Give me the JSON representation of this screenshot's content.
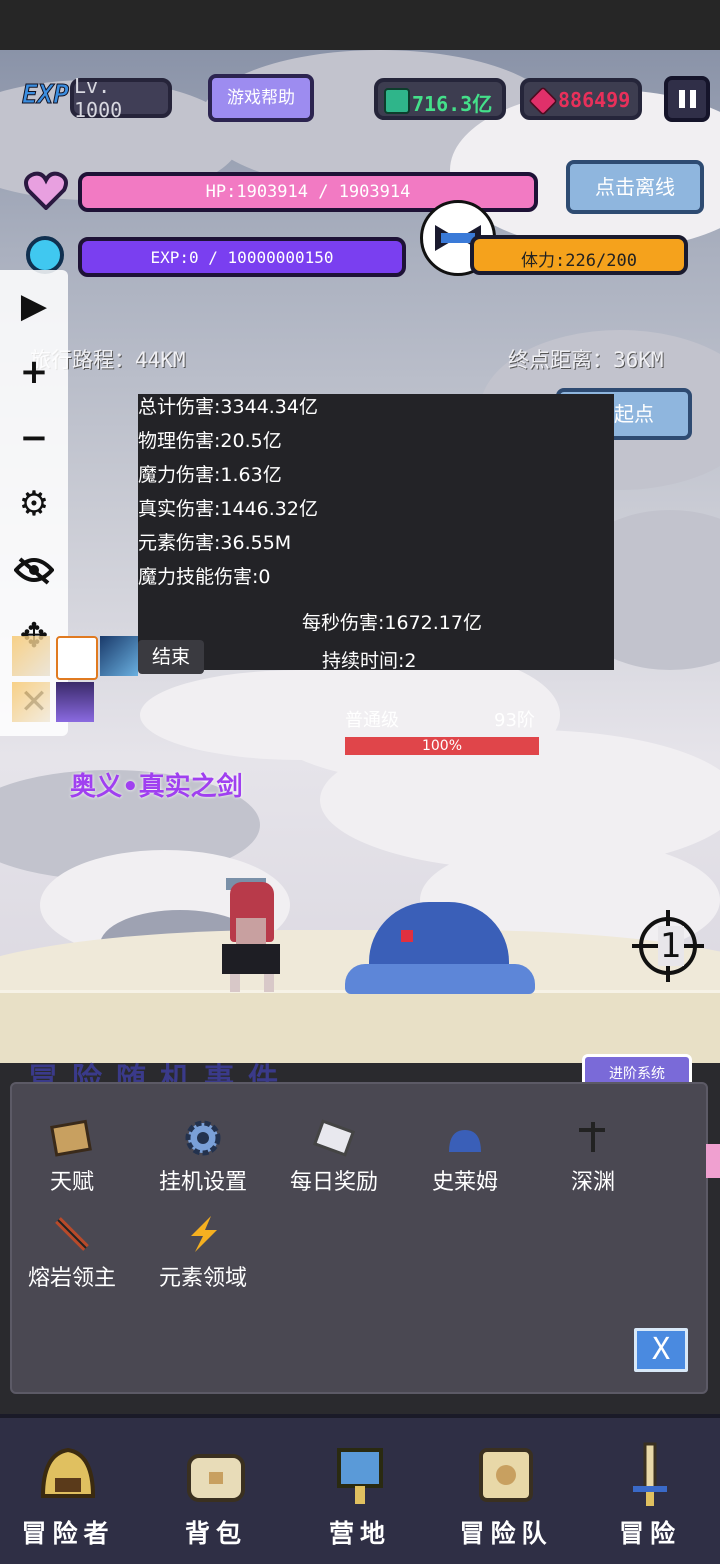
{
  "header": {
    "exp_badge": "EXP",
    "level": "Lv. 1000",
    "help_button": "游戏帮助",
    "green_currency": "716.3亿",
    "red_currency": "886499",
    "pause_icon": "pause-icon"
  },
  "bars": {
    "hp_text": "HP:1903914 / 1903914",
    "hp_fraction": 1.0,
    "exp_text": "EXP:0 / 10000000150",
    "exp_fraction": 0.0,
    "stamina_text": "体力:226/200",
    "offline_button": "点击离线"
  },
  "journey": {
    "travel_label": "旅行路程：44KM",
    "end_label": "终点距离：36KM",
    "back_button": "回起点"
  },
  "damage_panel": {
    "lines": [
      "总计伤害:3344.34亿",
      "物理伤害:20.5亿",
      "魔力伤害:1.63亿",
      "真实伤害:1446.32亿",
      "元素伤害:36.55M",
      "魔力技能伤害:0"
    ],
    "dps": "每秒伤害:1672.17亿",
    "duration": "持续时间:2",
    "end_button": "结束"
  },
  "enemy": {
    "level_label": "普通级",
    "rank_label": "93阶",
    "hp_percent_text": "100%",
    "hp_fraction": 1.0
  },
  "skill_text": "奥义•真实之剑",
  "event_text": "冒险随机事件",
  "advance_tag": "进阶系统",
  "popup": {
    "items": [
      {
        "label": "天赋",
        "icon": "book-icon"
      },
      {
        "label": "挂机设置",
        "icon": "gear-icon"
      },
      {
        "label": "每日奖励",
        "icon": "scroll-icon"
      },
      {
        "label": "史莱姆",
        "icon": "slime-icon"
      },
      {
        "label": "深渊",
        "icon": "abyss-icon"
      },
      {
        "label": "熔岩领主",
        "icon": "lava-sword-icon"
      },
      {
        "label": "元素领域",
        "icon": "element-icon"
      }
    ],
    "close_label": "X"
  },
  "target_counter": "1",
  "nav": [
    {
      "label": "冒险者",
      "icon": "helmet-icon"
    },
    {
      "label": "背包",
      "icon": "chest-icon"
    },
    {
      "label": "营地",
      "icon": "camp-icon"
    },
    {
      "label": "冒险队",
      "icon": "team-book-icon"
    },
    {
      "label": "冒险",
      "icon": "sword-icon"
    }
  ],
  "colors": {
    "hp_pink": "#f27ac3",
    "exp_purple": "#7a3ff0",
    "stamina_orange": "#f5a21c",
    "enemy_hp_red": "#e0454a",
    "panel_bg": "#232327",
    "popup_bg": "#4a4852",
    "nav_bg": "#2f2f45"
  }
}
